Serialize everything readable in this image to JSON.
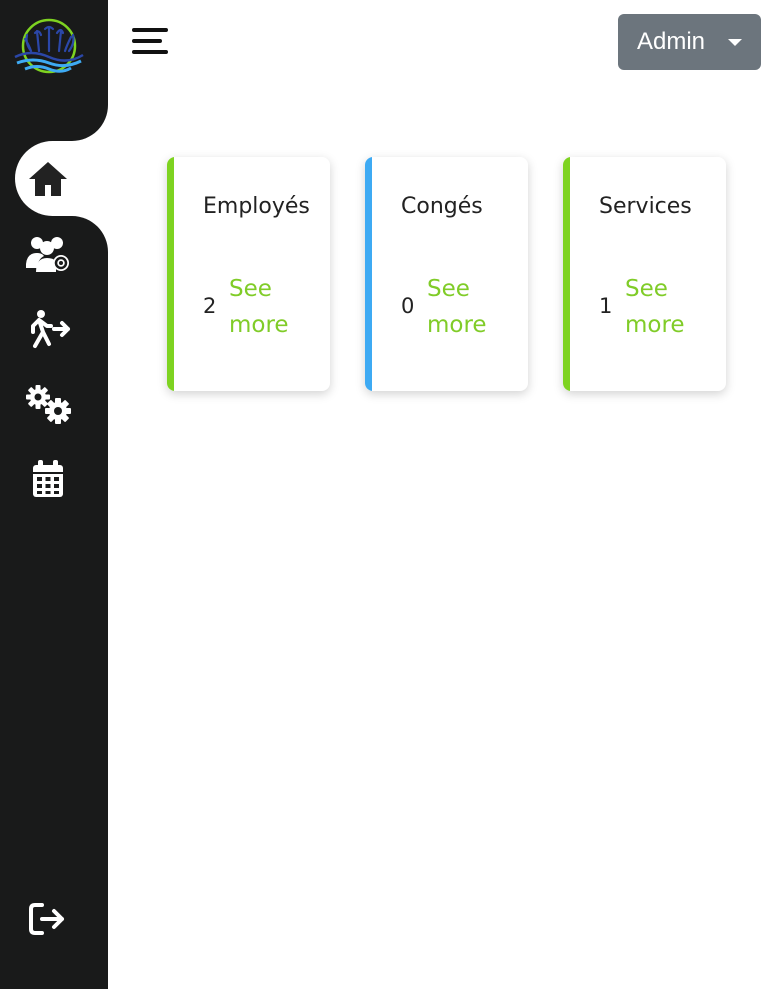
{
  "header": {
    "menu_icon": "hamburger-menu-icon",
    "user_menu_label": "Admin"
  },
  "sidebar": {
    "logo": "lake-logo",
    "items": [
      {
        "id": "home",
        "icon": "home-icon",
        "active": true
      },
      {
        "id": "employees",
        "icon": "users-gear-icon",
        "active": false
      },
      {
        "id": "leaves",
        "icon": "person-walking-arrow-icon",
        "active": false
      },
      {
        "id": "services",
        "icon": "gears-icon",
        "active": false
      },
      {
        "id": "calendar",
        "icon": "calendar-icon",
        "active": false
      }
    ],
    "logout_icon": "logout-icon"
  },
  "cards": [
    {
      "title": "Employés",
      "count": "2",
      "link": "See more",
      "accent": "#7ed321"
    },
    {
      "title": "Congés",
      "count": "0",
      "link": "See more",
      "accent": "#3eaaf3"
    },
    {
      "title": "Services",
      "count": "1",
      "link": "See more",
      "accent": "#7ed321"
    }
  ],
  "colors": {
    "sidebar_bg": "#191a1a",
    "link_green": "#80cc28",
    "button_gray": "#6c757d"
  }
}
